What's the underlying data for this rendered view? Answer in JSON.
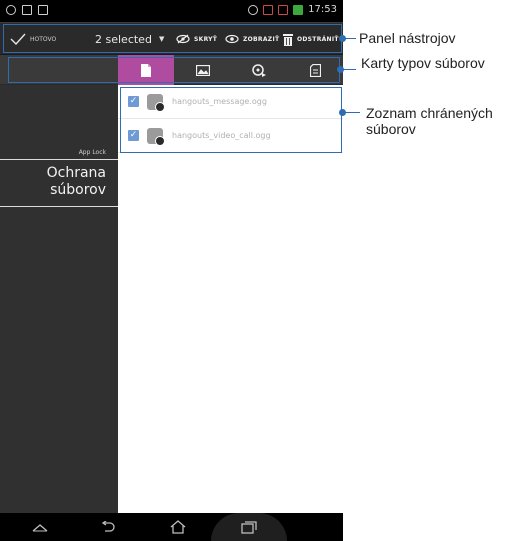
{
  "status_bar": {
    "time": "17:53"
  },
  "action_bar": {
    "done_label": "HOTOVO",
    "selection_label": "2 selected",
    "hide_label": "SKRYŤ",
    "show_label": "ZOBRAZIŤ",
    "delete_label": "ODSTRÁNIŤ"
  },
  "tabs": [
    {
      "name": "documents",
      "icon": "document-icon",
      "active": true
    },
    {
      "name": "images",
      "icon": "image-icon",
      "active": false
    },
    {
      "name": "videos",
      "icon": "video-icon",
      "active": false
    },
    {
      "name": "other",
      "icon": "file-icon",
      "active": false
    }
  ],
  "sidebar": {
    "section_label": "App Lock",
    "item_label": "Ochrana súborov"
  },
  "files": [
    {
      "name": "hangouts_message.ogg",
      "checked": true
    },
    {
      "name": "hangouts_video_call.ogg",
      "checked": true
    }
  ],
  "callouts": {
    "toolbar": "Panel nástrojov",
    "file_tabs": "Karty typov súborov",
    "protected_list": "Zoznam chránených súborov"
  },
  "colors": {
    "accent_tab": "#b04c9f",
    "callout": "#2f6db2",
    "checkbox": "#6e9bd6"
  }
}
